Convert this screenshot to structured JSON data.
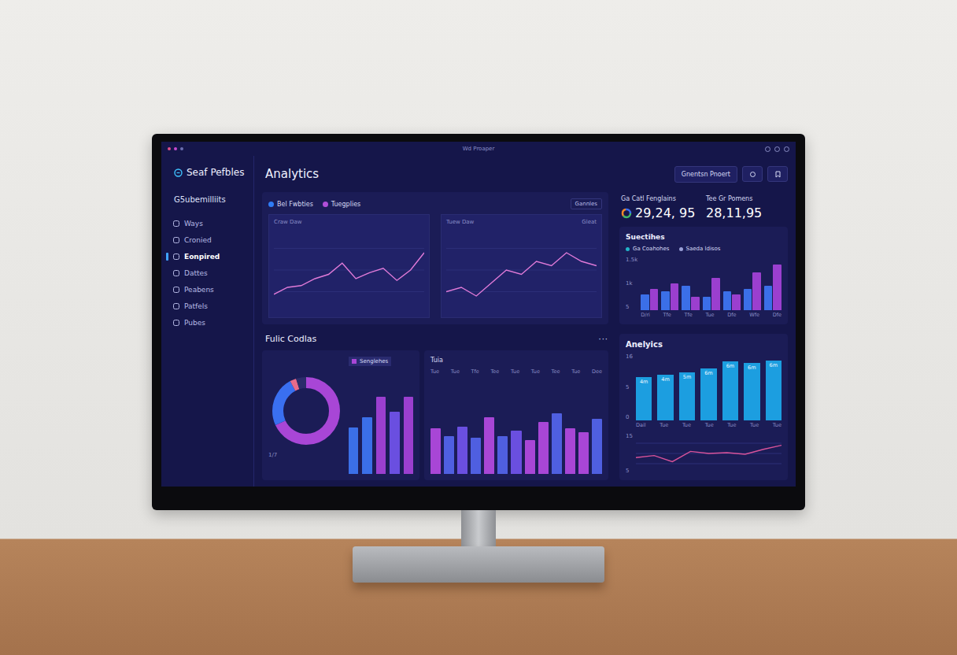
{
  "window": {
    "title": "Wd Proaper"
  },
  "sidebar": {
    "brand": "Seaf Pefbles",
    "heading": "G5ubemilliits",
    "items": [
      {
        "label": "Ways",
        "selected": false
      },
      {
        "label": "Cronied",
        "selected": false
      },
      {
        "label": "Eonpired",
        "selected": true
      },
      {
        "label": "Dattes",
        "selected": false
      },
      {
        "label": "Peabens",
        "selected": false
      },
      {
        "label": "Patfels",
        "selected": false
      },
      {
        "label": "Pubes",
        "selected": false
      }
    ]
  },
  "header": {
    "title": "Analytics",
    "button": "Gnentsn Pnoert"
  },
  "trends": {
    "legend": [
      {
        "label": "Bel Fwbties",
        "color": "#2f7cf6"
      },
      {
        "label": "Tuegplies",
        "color": "#b04fd8"
      }
    ],
    "tag": "Gannles",
    "charts": [
      {
        "title": "Craw Daw",
        "action": "",
        "values": [
          22,
          30,
          32,
          40,
          45,
          58,
          40,
          47,
          52,
          38,
          50,
          70
        ]
      },
      {
        "title": "Tuew Daw",
        "action": "Gleat",
        "values": [
          25,
          30,
          20,
          35,
          50,
          45,
          60,
          55,
          70,
          60,
          55
        ]
      }
    ]
  },
  "stats": [
    {
      "label": "Ga Catl Fenglains",
      "value": "29,24, 95",
      "kind": "ring"
    },
    {
      "label": "Tee Gr Pomens",
      "value": "28,11,95",
      "kind": "plain"
    }
  ],
  "activity": {
    "title": "Suectihes",
    "legend": [
      {
        "label": "Ga Coahohes",
        "color": "#22b3c9"
      },
      {
        "label": "Saeda ldisos",
        "color": "#9aa0d8"
      }
    ],
    "y_ticks": [
      "1.5k",
      "1k",
      "5"
    ],
    "x_ticks": [
      "D/ri",
      "Tfe",
      "Tfe",
      "Tue",
      "Dfe",
      "Wfe",
      "Dfe"
    ],
    "series": [
      {
        "color": "#3b6fe8",
        "values": [
          30,
          35,
          45,
          25,
          35,
          40,
          45
        ]
      },
      {
        "color": "#9b3fcf",
        "values": [
          40,
          50,
          25,
          60,
          30,
          70,
          85
        ]
      }
    ]
  },
  "breakdown": {
    "title": "Fulic Codlas",
    "menu": "···",
    "legend": "Senglehes",
    "foot": "1/7",
    "donut": [
      {
        "value": 68,
        "color": "#a846d6"
      },
      {
        "value": 24,
        "color": "#3a6ff0"
      },
      {
        "value": 3,
        "color": "#e86b8a"
      },
      {
        "value": 5,
        "color": "#2a2c6a"
      }
    ],
    "bars": [
      {
        "value": 45,
        "color": "#3b6fe8"
      },
      {
        "value": 55,
        "color": "#3b6fe8"
      },
      {
        "value": 75,
        "color": "#9b3fcf"
      },
      {
        "value": 60,
        "color": "#6a4fe0"
      },
      {
        "value": 75,
        "color": "#9b3fcf"
      }
    ]
  },
  "tuia": {
    "title": "Tuia",
    "x_ticks": [
      "Tue",
      "Tue",
      "Tfe",
      "Tee",
      "Tue",
      "Tue",
      "Tee",
      "Tue",
      "Dee"
    ],
    "bars": [
      {
        "value": 48,
        "color": "#a846d6"
      },
      {
        "value": 40,
        "color": "#4f5fe0"
      },
      {
        "value": 50,
        "color": "#6a4fe0"
      },
      {
        "value": 38,
        "color": "#4f5fe0"
      },
      {
        "value": 60,
        "color": "#a846d6"
      },
      {
        "value": 40,
        "color": "#4f5fe0"
      },
      {
        "value": 46,
        "color": "#6a4fe0"
      },
      {
        "value": 36,
        "color": "#a846d6"
      },
      {
        "value": 55,
        "color": "#a846d6"
      },
      {
        "value": 64,
        "color": "#4f5fe0"
      },
      {
        "value": 48,
        "color": "#a846d6"
      },
      {
        "value": 44,
        "color": "#a846d6"
      },
      {
        "value": 58,
        "color": "#4f5fe0"
      }
    ]
  },
  "analytics": {
    "title": "Anelyics",
    "y_ticks": [
      "16",
      "5",
      "0"
    ],
    "bars": [
      {
        "value": 65,
        "top": "4m",
        "label": "Dail"
      },
      {
        "value": 68,
        "top": "4m",
        "label": "Tue"
      },
      {
        "value": 72,
        "top": "5m",
        "label": "Tue"
      },
      {
        "value": 78,
        "top": "6m",
        "label": "Tue"
      },
      {
        "value": 88,
        "top": "6m",
        "label": "Tue"
      },
      {
        "value": 86,
        "top": "6m",
        "label": "Tue"
      },
      {
        "value": 90,
        "top": "6m",
        "label": "Tue"
      }
    ],
    "line_ticks": [
      "15",
      "5"
    ],
    "line": [
      40,
      45,
      30,
      55,
      50,
      52,
      48,
      60,
      70
    ]
  }
}
